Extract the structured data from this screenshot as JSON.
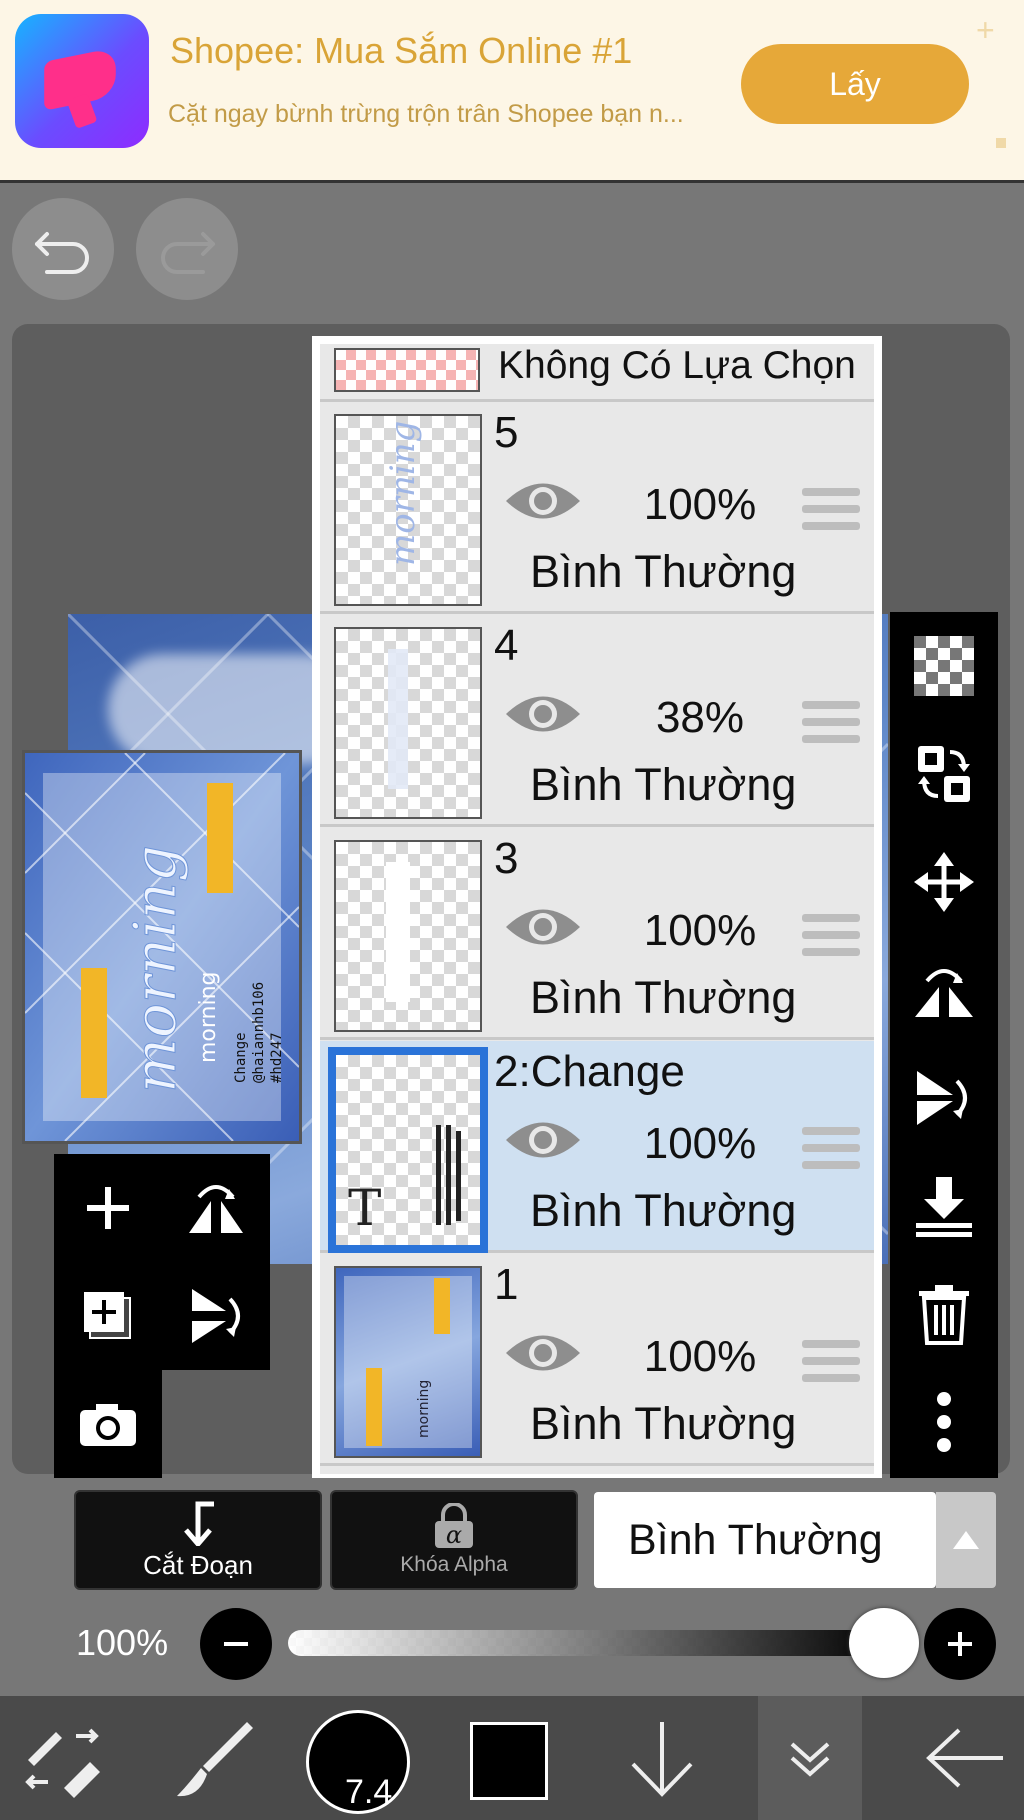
{
  "ad": {
    "title": "Shopee: Mua Sắm Online #1",
    "subtitle": "Cặt ngay bừnh trừng trộn trân Shopee bạn n...",
    "button": "Lấy",
    "brand_color": "#e6a839"
  },
  "toolbar_top": {
    "undo_icon": "undo-icon",
    "redo_icon": "redo-icon"
  },
  "layers_panel": {
    "selection_row_label": "Không Có Lựa Chọn",
    "layers": [
      {
        "name": "5",
        "opacity": "100%",
        "blend": "Bình Thường",
        "visible": true
      },
      {
        "name": "4",
        "opacity": "38%",
        "blend": "Bình Thường",
        "visible": true
      },
      {
        "name": "3",
        "opacity": "100%",
        "blend": "Bình Thường",
        "visible": true
      },
      {
        "name": "2:Change",
        "opacity": "100%",
        "blend": "Bình Thường",
        "visible": true,
        "active": true,
        "thumb_type_letter": "T"
      },
      {
        "name": "1",
        "opacity": "100%",
        "blend": "Bình Thường",
        "visible": true
      }
    ]
  },
  "options": {
    "clipping_label": "Cắt Đoạn",
    "alpha_lock_label": "Khóa Alpha",
    "blend_mode": "Bình Thường"
  },
  "opacity": {
    "value": "100%",
    "level": 1.0
  },
  "brush": {
    "size": "7.4",
    "color": "#000000"
  },
  "colors": {
    "active_layer_bg": "#cfe0f1",
    "active_layer_border": "#2a73d8",
    "panel_bg": "#e8e8e8"
  }
}
